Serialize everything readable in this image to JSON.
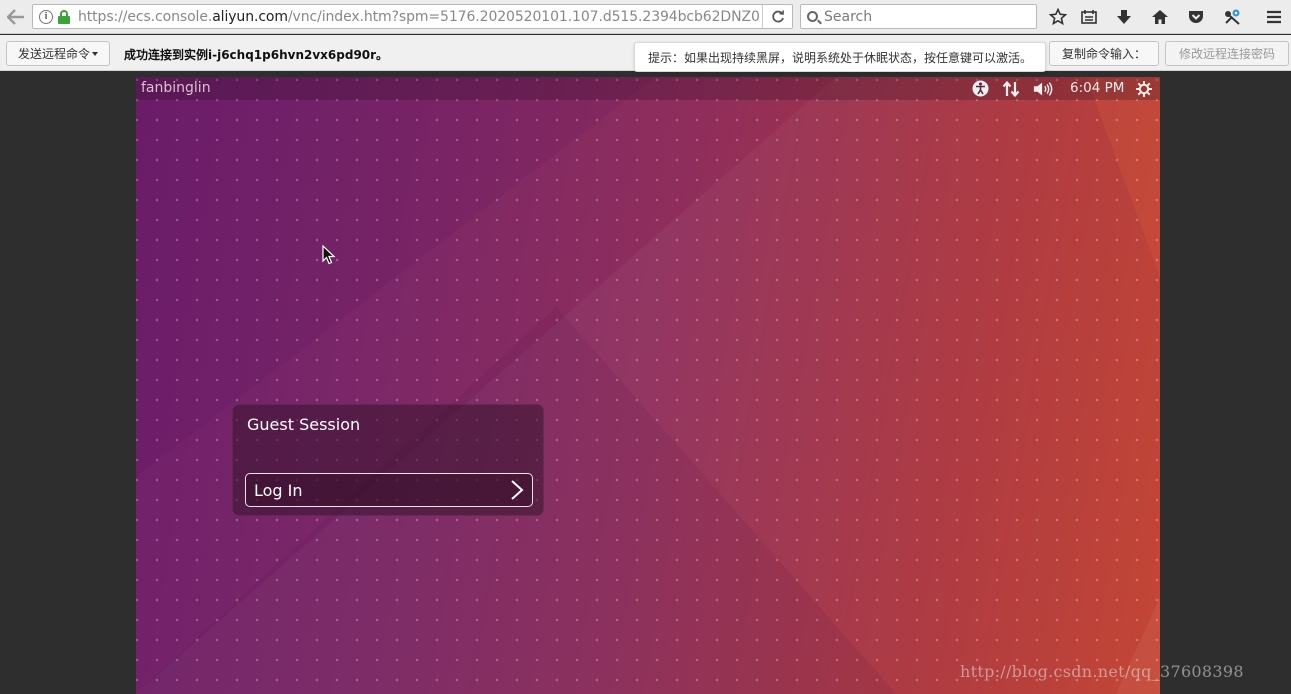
{
  "browser": {
    "url": {
      "prefix": "https://ecs.console.",
      "domain": "aliyun.com",
      "suffix": "/vnc/index.htm?spm=5176.2020520101.107.d515.2394bcb62DNZ0"
    },
    "search_placeholder": "Search",
    "icons": [
      "back-icon",
      "info-icon",
      "lock-icon",
      "reload-icon",
      "search-icon",
      "bookmark-star-icon",
      "reader-list-icon",
      "download-icon",
      "home-icon",
      "pocket-icon",
      "extension-icon",
      "menu-icon"
    ]
  },
  "vnc_toolbar": {
    "send_command_label": "发送远程命令",
    "status_message": "成功连接到实例i-j6chq1p6hvn2vx6pd90r。",
    "hint": "提示：如果出现持续黑屏，说明系统处于休眠状态，按任意键可以激活。",
    "copy_command_label": "复制命令输入：",
    "change_password_label": "修改远程连接密码"
  },
  "ubuntu": {
    "panel": {
      "hostname": "fanbinglin",
      "clock": "6:04 PM",
      "icons": [
        "accessibility-icon",
        "network-icon",
        "volume-icon",
        "power-gear-icon"
      ]
    },
    "login": {
      "session_name": "Guest Session",
      "button_label": "Log In"
    }
  },
  "watermark": "http://blog.csdn.net/qq_37608398",
  "colors": {
    "lock_green": "#3aa33a",
    "wallpaper_purple": "#6e1f6b",
    "wallpaper_orange": "#c23f2c"
  }
}
